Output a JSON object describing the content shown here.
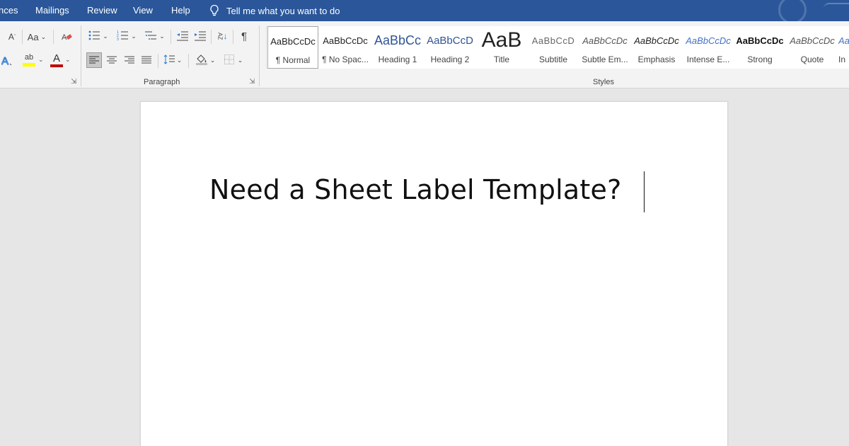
{
  "tabs": [
    {
      "label": "nces"
    },
    {
      "label": "Mailings"
    },
    {
      "label": "Review"
    },
    {
      "label": "View"
    },
    {
      "label": "Help"
    }
  ],
  "tell_me": {
    "text": "Tell me what you want to do",
    "icon": "lightbulb-icon"
  },
  "ribbon": {
    "font": {
      "change_case_label": "Aa",
      "highlight_label": "ab",
      "font_color_label": "A",
      "shrink_label": "A"
    },
    "paragraph": {
      "group_label": "Paragraph",
      "sort_label": "AZ",
      "pilcrow": "¶"
    },
    "styles": {
      "group_label": "Styles",
      "items": [
        {
          "preview": "AaBbCcDc",
          "name": "¶ Normal"
        },
        {
          "preview": "AaBbCcDc",
          "name": "¶ No Spac..."
        },
        {
          "preview": "AaBbCc",
          "name": "Heading 1"
        },
        {
          "preview": "AaBbCcD",
          "name": "Heading 2"
        },
        {
          "preview": "AaB",
          "name": "Title"
        },
        {
          "preview": "AaBbCcD",
          "name": "Subtitle"
        },
        {
          "preview": "AaBbCcDc",
          "name": "Subtle Em..."
        },
        {
          "preview": "AaBbCcDc",
          "name": "Emphasis"
        },
        {
          "preview": "AaBbCcDc",
          "name": "Intense E..."
        },
        {
          "preview": "AaBbCcDc",
          "name": "Strong"
        },
        {
          "preview": "AaBbCcDc",
          "name": "Quote"
        },
        {
          "preview": "Aa",
          "name": "In"
        }
      ]
    }
  },
  "colors": {
    "tabbar": "#2b579a",
    "highlight": "#ffff00",
    "font_color": "#c00000",
    "heading_blue": "#2f5496",
    "intense_blue": "#4472c4"
  },
  "document": {
    "text": "Need a Sheet Label Template?"
  }
}
